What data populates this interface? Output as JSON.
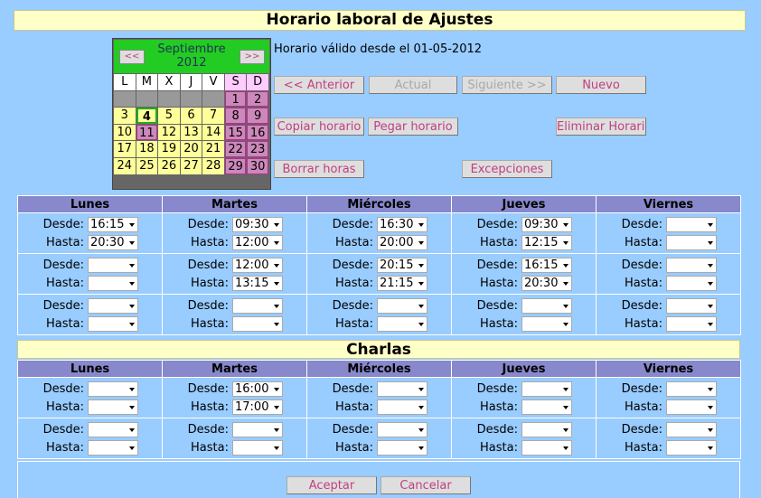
{
  "title": "Horario laboral de Ajustes",
  "calendar": {
    "prev": "<<",
    "next": ">>",
    "month": "Septiembre",
    "year": "2012",
    "days_header": [
      "L",
      "M",
      "X",
      "J",
      "V",
      "S",
      "D"
    ],
    "weeks": [
      [
        "",
        "",
        "",
        "",
        "",
        "1",
        "2"
      ],
      [
        "3",
        "4",
        "5",
        "6",
        "7",
        "8",
        "9"
      ],
      [
        "10",
        "11",
        "12",
        "13",
        "14",
        "15",
        "16"
      ],
      [
        "17",
        "18",
        "19",
        "20",
        "21",
        "22",
        "23"
      ],
      [
        "24",
        "25",
        "26",
        "27",
        "28",
        "29",
        "30"
      ]
    ],
    "today": "4"
  },
  "valid_from": "Horario válido desde el 01-05-2012",
  "buttons": {
    "anterior": "<< Anterior",
    "actual": "Actual",
    "siguiente": "Siguiente >>",
    "nuevo": "Nuevo",
    "copiar": "Copiar horario",
    "pegar": "Pegar horario",
    "eliminar": "Eliminar Horario",
    "borrar": "Borrar horas",
    "excepciones": "Excepciones",
    "aceptar": "Aceptar",
    "cancelar": "Cancelar"
  },
  "days": [
    "Lunes",
    "Martes",
    "Miércoles",
    "Jueves",
    "Viernes"
  ],
  "labels": {
    "desde": "Desde:",
    "hasta": "Hasta:"
  },
  "work": [
    [
      [
        "16:15",
        "20:30"
      ],
      [
        "09:30",
        "12:00"
      ],
      [
        "16:30",
        "20:00"
      ],
      [
        "09:30",
        "12:15"
      ],
      [
        "",
        ""
      ]
    ],
    [
      [
        "",
        ""
      ],
      [
        "12:00",
        "13:15"
      ],
      [
        "20:15",
        "21:15"
      ],
      [
        "16:15",
        "20:30"
      ],
      [
        "",
        ""
      ]
    ],
    [
      [
        "",
        ""
      ],
      [
        "",
        ""
      ],
      [
        "",
        ""
      ],
      [
        "",
        ""
      ],
      [
        "",
        ""
      ]
    ]
  ],
  "section2": "Charlas",
  "talks": [
    [
      [
        "",
        ""
      ],
      [
        "16:00",
        "17:00"
      ],
      [
        "",
        ""
      ],
      [
        "",
        ""
      ],
      [
        "",
        ""
      ]
    ],
    [
      [
        "",
        ""
      ],
      [
        "",
        ""
      ],
      [
        "",
        ""
      ],
      [
        "",
        ""
      ],
      [
        "",
        ""
      ]
    ]
  ]
}
